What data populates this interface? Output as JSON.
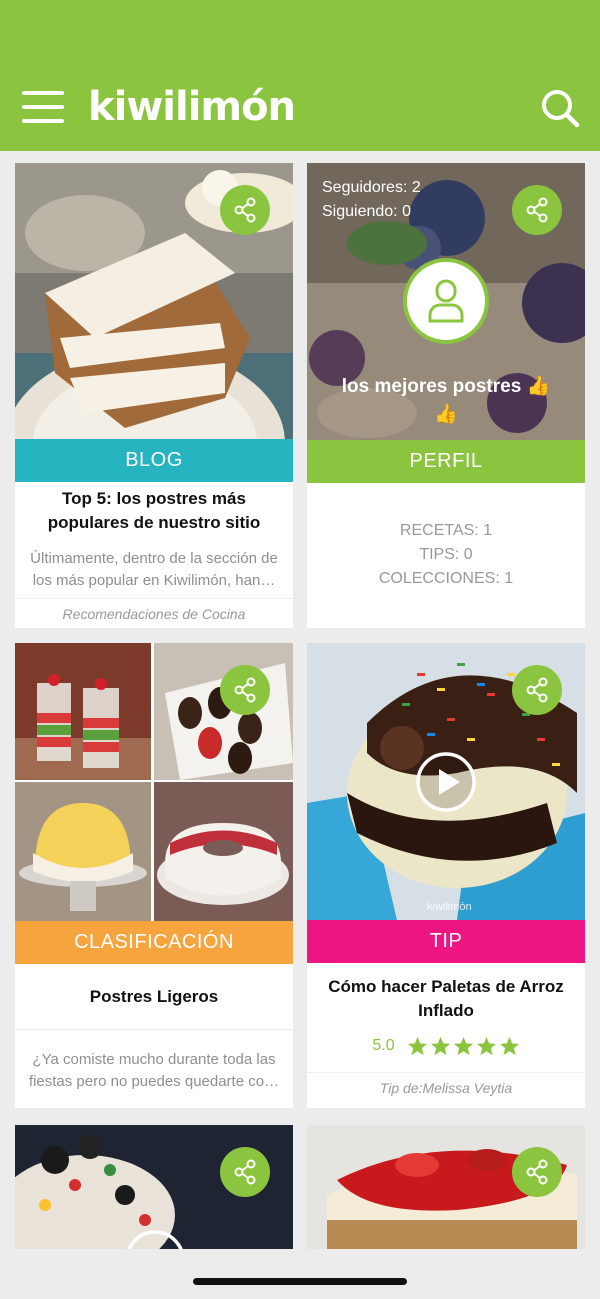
{
  "app": {
    "logo": "kiwilimón"
  },
  "icons": {
    "menu": "hamburger-menu-icon",
    "search": "search-icon",
    "share": "share-icon",
    "profile": "user-icon",
    "play": "play-icon",
    "star": "star-icon"
  },
  "colors": {
    "brand": "#8bc53f",
    "blog": "#26b4c0",
    "perfil": "#8bc53f",
    "clasificacion": "#f6a53e",
    "tip": "#ec1582"
  },
  "cards": {
    "blog": {
      "category": "BLOG",
      "title": "Top 5: los postres más populares de nuestro sitio",
      "description_line1": "Últimamente, dentro de la sección de",
      "description_line2": "los más popular en Kiwilimón, han…",
      "footer": "Recomendaciones de Cocina"
    },
    "perfil": {
      "category": "PERFIL",
      "followers": "Seguidores: 2",
      "following": "Siguiendo: 0",
      "name": "los mejores postres 👍",
      "name_emoji": "👍",
      "recetas": "RECETAS: 1",
      "tips": "TIPS: 0",
      "colecciones": "COLECCIONES: 1"
    },
    "clasificacion": {
      "category": "CLASIFICACIÓN",
      "title": "Postres Ligeros",
      "description_line1": "¿Ya comiste mucho durante toda las",
      "description_line2": "fiestas pero no puedes quedarte co…"
    },
    "tip": {
      "category": "TIP",
      "title": "Cómo hacer Paletas de Arroz Inflado",
      "rating": "5.0",
      "stars": 5,
      "author": "Tip de:Melissa  Veytia",
      "watermark": "kiwilimón"
    }
  }
}
